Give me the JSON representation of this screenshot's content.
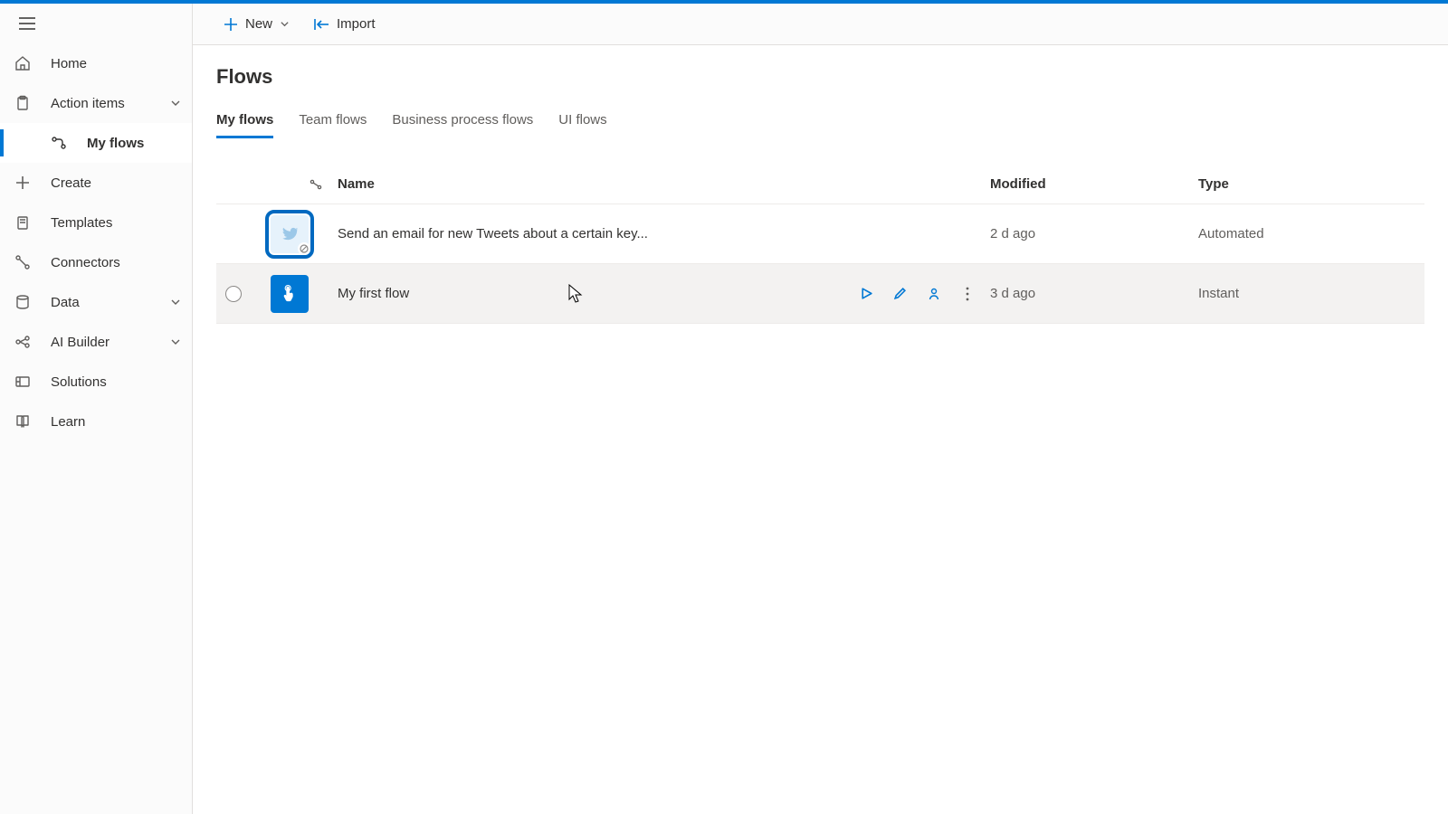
{
  "colors": {
    "accent": "#0078d4",
    "text": "#323130",
    "muted": "#605e5c",
    "border": "#e1dfdd"
  },
  "sidebar": {
    "items": [
      {
        "label": "Home",
        "icon": "home-icon",
        "expandable": false,
        "selected": false,
        "sub": false
      },
      {
        "label": "Action items",
        "icon": "clipboard-icon",
        "expandable": true,
        "selected": false,
        "sub": false
      },
      {
        "label": "My flows",
        "icon": "flow-icon",
        "expandable": false,
        "selected": true,
        "sub": true
      },
      {
        "label": "Create",
        "icon": "plus-icon",
        "expandable": false,
        "selected": false,
        "sub": false
      },
      {
        "label": "Templates",
        "icon": "templates-icon",
        "expandable": false,
        "selected": false,
        "sub": false
      },
      {
        "label": "Connectors",
        "icon": "connectors-icon",
        "expandable": false,
        "selected": false,
        "sub": false
      },
      {
        "label": "Data",
        "icon": "data-icon",
        "expandable": true,
        "selected": false,
        "sub": false
      },
      {
        "label": "AI Builder",
        "icon": "ai-builder-icon",
        "expandable": true,
        "selected": false,
        "sub": false
      },
      {
        "label": "Solutions",
        "icon": "solutions-icon",
        "expandable": false,
        "selected": false,
        "sub": false
      },
      {
        "label": "Learn",
        "icon": "learn-icon",
        "expandable": false,
        "selected": false,
        "sub": false
      }
    ]
  },
  "command_bar": {
    "new_label": "New",
    "import_label": "Import"
  },
  "page": {
    "title": "Flows",
    "tabs": [
      {
        "label": "My flows",
        "active": true
      },
      {
        "label": "Team flows",
        "active": false
      },
      {
        "label": "Business process flows",
        "active": false
      },
      {
        "label": "UI flows",
        "active": false
      }
    ],
    "columns": {
      "name": "Name",
      "modified": "Modified",
      "type": "Type"
    },
    "rows": [
      {
        "name": "Send an email for new Tweets about a certain key...",
        "modified": "2 d ago",
        "type": "Automated",
        "tile": "twitter",
        "highlight": true,
        "disabled_badge": true,
        "hover": false,
        "show_actions": false,
        "show_check": false
      },
      {
        "name": "My first flow",
        "modified": "3 d ago",
        "type": "Instant",
        "tile": "button",
        "highlight": false,
        "disabled_badge": false,
        "hover": true,
        "show_actions": true,
        "show_check": true
      }
    ]
  }
}
